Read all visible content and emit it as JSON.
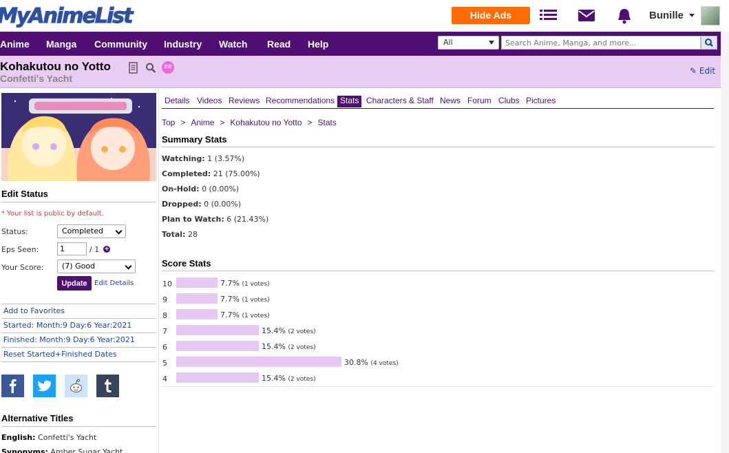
{
  "header": {
    "logo_text": "MyAnimeList",
    "hide_ads_label": "Hide Ads",
    "username": "Bunille"
  },
  "nav": {
    "items": [
      "Anime",
      "Manga",
      "Community",
      "Industry",
      "Watch",
      "Read",
      "Help"
    ],
    "search_scope": "All",
    "search_placeholder": "Search Anime, Manga, and more..."
  },
  "title": {
    "main": "Kohakutou no Yotto",
    "english": "Confetti's Yacht",
    "badge": "手動",
    "edit_label": "Edit"
  },
  "edit_status": {
    "heading": "Edit Status",
    "public_note": "* Your list is public by default.",
    "status_label": "Status:",
    "status_value": "Completed",
    "eps_label": "Eps Seen:",
    "eps_value": "1",
    "eps_total": "/ 1",
    "score_label": "Your Score:",
    "score_value": "(7) Good",
    "update_label": "Update",
    "edit_details_label": "Edit Details"
  },
  "side_links": {
    "favorites": "Add to Favorites",
    "started": "Started: Month:9 Day:6 Year:2021",
    "finished": "Finished: Month:9 Day:6 Year:2021",
    "reset": "Reset Started+Finished Dates"
  },
  "alt_titles": {
    "heading": "Alternative Titles",
    "english_label": "English:",
    "english_value": "Confetti's Yacht",
    "synonyms_label": "Synonyms:",
    "synonyms_value": "Amber Sugar Yacht"
  },
  "tabs": [
    "Details",
    "Videos",
    "Reviews",
    "Recommendations",
    "Stats",
    "Characters & Staff",
    "News",
    "Forum",
    "Clubs",
    "Pictures"
  ],
  "active_tab": "Stats",
  "breadcrumb": [
    "Top",
    "Anime",
    "Kohakutou no Yotto",
    "Stats"
  ],
  "summary": {
    "heading": "Summary Stats",
    "rows": [
      {
        "label": "Watching:",
        "value": "1 (3.57%)"
      },
      {
        "label": "Completed:",
        "value": "21 (75.00%)"
      },
      {
        "label": "On-Hold:",
        "value": "0 (0.00%)"
      },
      {
        "label": "Dropped:",
        "value": "0 (0.00%)"
      },
      {
        "label": "Plan to Watch:",
        "value": "6 (21.43%)"
      },
      {
        "label": "Total:",
        "value": "28"
      }
    ]
  },
  "score_stats": {
    "heading": "Score Stats",
    "rows": [
      {
        "score": "10",
        "percent": 7.7,
        "pct_label": "7.7%",
        "votes": "(1 votes)"
      },
      {
        "score": "9",
        "percent": 7.7,
        "pct_label": "7.7%",
        "votes": "(1 votes)"
      },
      {
        "score": "8",
        "percent": 7.7,
        "pct_label": "7.7%",
        "votes": "(1 votes)"
      },
      {
        "score": "7",
        "percent": 15.4,
        "pct_label": "15.4%",
        "votes": "(2 votes)"
      },
      {
        "score": "6",
        "percent": 15.4,
        "pct_label": "15.4%",
        "votes": "(2 votes)"
      },
      {
        "score": "5",
        "percent": 30.8,
        "pct_label": "30.8%",
        "votes": "(4 votes)"
      },
      {
        "score": "4",
        "percent": 15.4,
        "pct_label": "15.4%",
        "votes": "(2 votes)"
      }
    ]
  },
  "colors": {
    "brand_purple": "#4f0f73",
    "title_bar": "#e8ccf2",
    "score_bar": "#e6c9f3",
    "hide_ads": "#ff6b00",
    "link": "#1c439b"
  }
}
